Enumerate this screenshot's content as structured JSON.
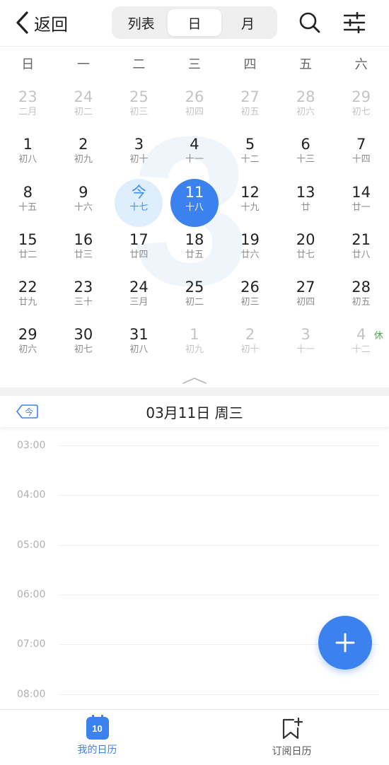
{
  "header": {
    "back_label": "返回",
    "segments": [
      {
        "label": "列表",
        "active": false
      },
      {
        "label": "日",
        "active": true
      },
      {
        "label": "月",
        "active": false
      }
    ],
    "search_icon": "search-icon",
    "filter_icon": "sliders-icon"
  },
  "weekdays": [
    "日",
    "一",
    "二",
    "三",
    "四",
    "五",
    "六"
  ],
  "month_watermark": "3",
  "calendar": {
    "weeks": [
      [
        {
          "day": "23",
          "lunar": "二月",
          "state": "dim"
        },
        {
          "day": "24",
          "lunar": "初二",
          "state": "dim"
        },
        {
          "day": "25",
          "lunar": "初三",
          "state": "dim"
        },
        {
          "day": "26",
          "lunar": "初四",
          "state": "dim"
        },
        {
          "day": "27",
          "lunar": "初五",
          "state": "dim"
        },
        {
          "day": "28",
          "lunar": "初六",
          "state": "dim"
        },
        {
          "day": "29",
          "lunar": "初七",
          "state": "dim"
        }
      ],
      [
        {
          "day": "1",
          "lunar": "初八"
        },
        {
          "day": "2",
          "lunar": "初九"
        },
        {
          "day": "3",
          "lunar": "初十"
        },
        {
          "day": "4",
          "lunar": "十一"
        },
        {
          "day": "5",
          "lunar": "十二"
        },
        {
          "day": "6",
          "lunar": "十三"
        },
        {
          "day": "7",
          "lunar": "十四"
        }
      ],
      [
        {
          "day": "8",
          "lunar": "十五"
        },
        {
          "day": "9",
          "lunar": "十六"
        },
        {
          "day": "今",
          "lunar": "十七",
          "state": "today"
        },
        {
          "day": "11",
          "lunar": "十八",
          "state": "selected"
        },
        {
          "day": "12",
          "lunar": "十九"
        },
        {
          "day": "13",
          "lunar": "廿"
        },
        {
          "day": "14",
          "lunar": "廿一"
        }
      ],
      [
        {
          "day": "15",
          "lunar": "廿二"
        },
        {
          "day": "16",
          "lunar": "廿三"
        },
        {
          "day": "17",
          "lunar": "廿四"
        },
        {
          "day": "18",
          "lunar": "廿五"
        },
        {
          "day": "19",
          "lunar": "廿六"
        },
        {
          "day": "20",
          "lunar": "廿七"
        },
        {
          "day": "21",
          "lunar": "廿八"
        }
      ],
      [
        {
          "day": "22",
          "lunar": "廿九"
        },
        {
          "day": "23",
          "lunar": "三十"
        },
        {
          "day": "24",
          "lunar": "三月"
        },
        {
          "day": "25",
          "lunar": "初二"
        },
        {
          "day": "26",
          "lunar": "初三"
        },
        {
          "day": "27",
          "lunar": "初四"
        },
        {
          "day": "28",
          "lunar": "初五"
        }
      ],
      [
        {
          "day": "29",
          "lunar": "初六"
        },
        {
          "day": "30",
          "lunar": "初七"
        },
        {
          "day": "31",
          "lunar": "初八"
        },
        {
          "day": "1",
          "lunar": "初九",
          "state": "dim"
        },
        {
          "day": "2",
          "lunar": "初十",
          "state": "dim"
        },
        {
          "day": "3",
          "lunar": "十一",
          "state": "dim"
        },
        {
          "day": "4",
          "lunar": "十二",
          "state": "dim",
          "badge": "休"
        }
      ]
    ]
  },
  "date_bar": {
    "today_tag": "今",
    "title": "03月11日 周三"
  },
  "timeline": {
    "hours": [
      "03:00",
      "04:00",
      "05:00",
      "06:00",
      "07:00",
      "08:00"
    ]
  },
  "fab_icon": "plus-icon",
  "tabbar": {
    "tabs": [
      {
        "label": "我的日历",
        "icon": "calendar-icon",
        "icon_text": "10",
        "active": true
      },
      {
        "label": "订阅日历",
        "icon": "bookmark-add-icon",
        "active": false
      }
    ]
  },
  "colors": {
    "accent": "#3b82ef",
    "today_bg": "#dfeefc",
    "holiday": "#4cae4c"
  }
}
